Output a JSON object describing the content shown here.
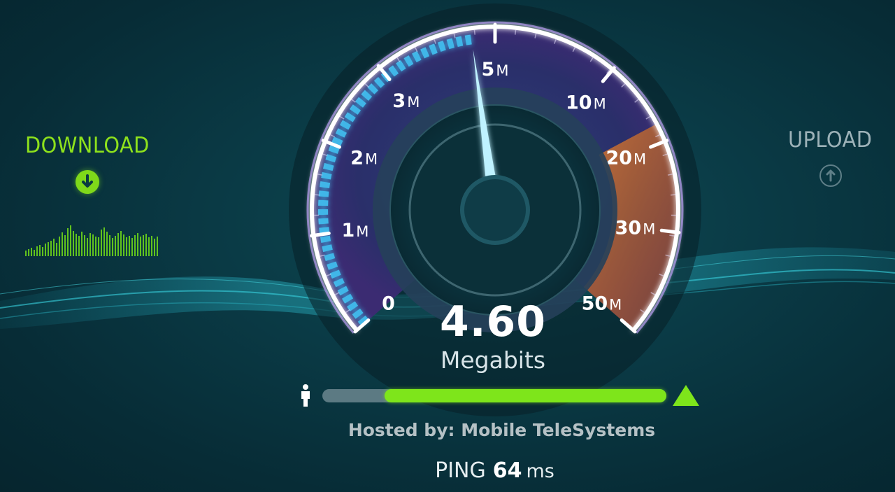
{
  "download": {
    "label": "DOWNLOAD",
    "icon": "arrow-down-circle-icon",
    "color": "#8ee21c"
  },
  "upload": {
    "label": "UPLOAD",
    "icon": "arrow-up-circle-icon",
    "color": "#9db2b8"
  },
  "gauge": {
    "needle_value_mbps": 4.6,
    "ticks": [
      {
        "value": "0",
        "unit": ""
      },
      {
        "value": "1",
        "unit": "M"
      },
      {
        "value": "2",
        "unit": "M"
      },
      {
        "value": "3",
        "unit": "M"
      },
      {
        "value": "5",
        "unit": "M"
      },
      {
        "value": "10",
        "unit": "M"
      },
      {
        "value": "20",
        "unit": "M"
      },
      {
        "value": "30",
        "unit": "M"
      },
      {
        "value": "50",
        "unit": "M"
      }
    ],
    "colors": {
      "progress": "#3fb6e8",
      "ring": "#9b7fe0",
      "high_zone": "#f08a3a"
    }
  },
  "result": {
    "value": "4.60",
    "unit": "Megabits"
  },
  "progress": {
    "fraction": 0.82,
    "start_icon": "person-icon",
    "end_icon": "triangle-icon",
    "color": "#7ee51b"
  },
  "server": {
    "hosted_text": "Hosted by: Mobile TeleSystems"
  },
  "ping": {
    "label": "PING",
    "value": "64",
    "unit": "ms"
  }
}
